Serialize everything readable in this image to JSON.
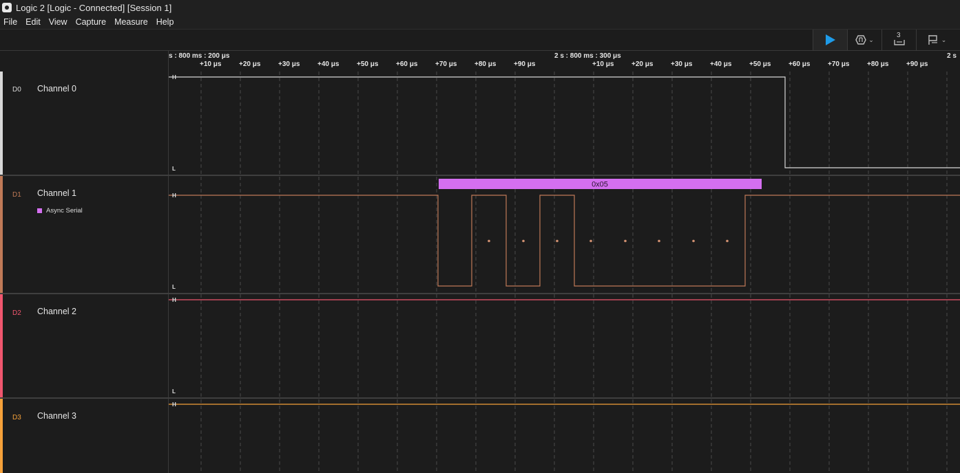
{
  "window": {
    "title": "Logic 2 [Logic - Connected] [Session 1]"
  },
  "menu": [
    "File",
    "Edit",
    "View",
    "Capture",
    "Measure",
    "Help"
  ],
  "toolbar": {
    "badge_count": "3"
  },
  "ruler": {
    "anchor_left": "s : 800 ms : 200 μs",
    "anchor_mid": "2 s : 800 ms : 300 μs",
    "anchor_right": "2 s",
    "ticks_a": [
      "+10 μs",
      "+20 μs",
      "+30 μs",
      "+40 μs",
      "+50 μs",
      "+60 μs",
      "+70 μs",
      "+80 μs",
      "+90 μs"
    ],
    "ticks_b": [
      "+10 μs",
      "+20 μs",
      "+30 μs",
      "+40 μs",
      "+50 μs",
      "+60 μs",
      "+70 μs",
      "+80 μs",
      "+90 μs"
    ]
  },
  "channels": [
    {
      "code": "D0",
      "name": "Channel 0",
      "color": "#d8d8d8"
    },
    {
      "code": "D1",
      "name": "Channel 1",
      "color": "#c07a57",
      "analyzer": "Async Serial"
    },
    {
      "code": "D2",
      "name": "Channel 2",
      "color": "#f0566e"
    },
    {
      "code": "D3",
      "name": "Channel 3",
      "color": "#f5a13a"
    }
  ],
  "levels": {
    "high": "H",
    "low": "L"
  },
  "decode": {
    "label": "0x05",
    "color": "#d46ff0"
  }
}
